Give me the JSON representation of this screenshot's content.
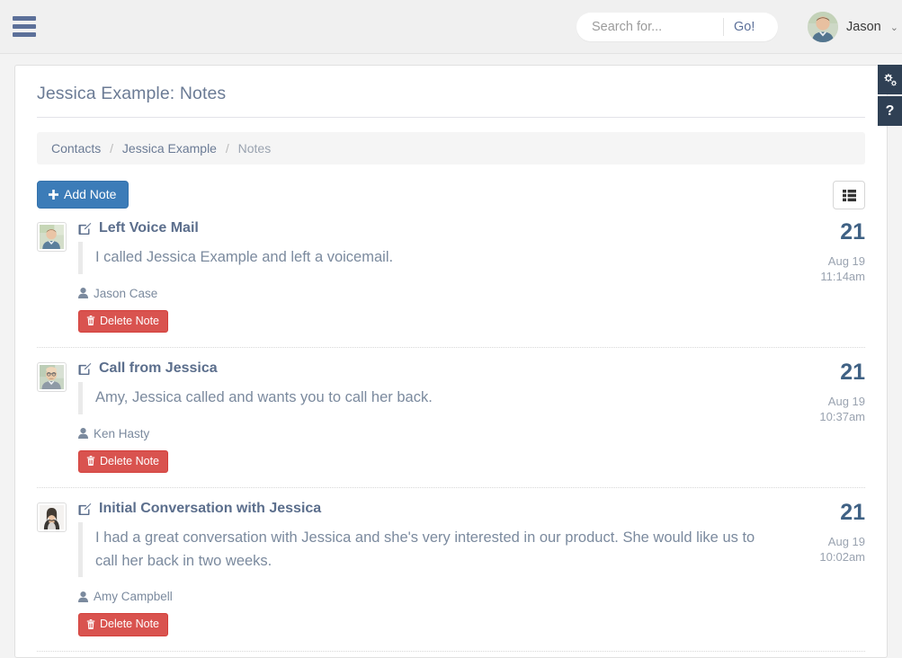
{
  "header": {
    "menu_icon": "hamburger-icon",
    "search": {
      "placeholder": "Search for...",
      "value": "",
      "submit_label": "Go!"
    },
    "user": {
      "name": "Jason",
      "caret": "⌄"
    }
  },
  "page": {
    "title": "Jessica Example: Notes",
    "breadcrumb": [
      {
        "label": "Contacts",
        "current": false
      },
      {
        "label": "Jessica Example",
        "current": false
      },
      {
        "label": "Notes",
        "current": true
      }
    ],
    "breadcrumb_separator": "/"
  },
  "toolbar": {
    "add_note_label": "Add Note",
    "add_note_icon": "plus-icon",
    "list_view_icon": "th-list-icon"
  },
  "notes": [
    {
      "title": "Left Voice Mail",
      "title_icon": "edit-square-icon",
      "body": "I called Jessica Example and left a voicemail.",
      "author": "Jason Case",
      "author_icon": "user-icon",
      "delete_label": "Delete Note",
      "delete_icon": "trash-icon",
      "avatar": "avatar-jason-case",
      "date": {
        "day": "21",
        "month_day": "Aug 19",
        "time": "11:14am"
      }
    },
    {
      "title": "Call from Jessica",
      "title_icon": "edit-square-icon",
      "body": "Amy, Jessica called and wants you to call her back.",
      "author": "Ken Hasty",
      "author_icon": "user-icon",
      "delete_label": "Delete Note",
      "delete_icon": "trash-icon",
      "avatar": "avatar-ken-hasty",
      "date": {
        "day": "21",
        "month_day": "Aug 19",
        "time": "10:37am"
      }
    },
    {
      "title": "Initial Conversation with Jessica",
      "title_icon": "edit-square-icon",
      "body": "I had a great conversation with Jessica and she's very interested in our product. She would like us to call her back in two weeks.",
      "author": "Amy Campbell",
      "author_icon": "user-icon",
      "delete_label": "Delete Note",
      "delete_icon": "trash-icon",
      "avatar": "avatar-amy-campbell",
      "date": {
        "day": "21",
        "month_day": "Aug 19",
        "time": "10:02am"
      }
    }
  ],
  "side_tabs": [
    {
      "icon": "cogs-icon",
      "label": ""
    },
    {
      "icon": "question-mark-icon",
      "label": "?"
    }
  ],
  "colors": {
    "primary_blue": "#3c7cb8",
    "danger_red": "#d9534f",
    "slate_text": "#5b6e8c",
    "muted_text": "#9aa3b0",
    "dark_navy": "#2f4054",
    "page_bg": "#f3f3f3"
  }
}
